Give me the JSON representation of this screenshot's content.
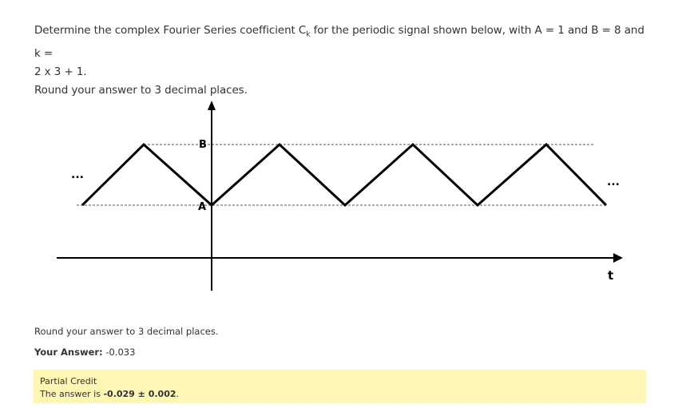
{
  "question": {
    "line1_pre": "Determine the complex Fourier Series coefficient C",
    "line1_sub": "k",
    "line1_post": " for the periodic signal shown below, with A = 1 and B = 8 and k =",
    "line2": "2 x 3 + 1.",
    "line3": "Round your answer to 3 decimal places."
  },
  "figure": {
    "label_B": "B",
    "label_A": "A",
    "axis_label_t": "t",
    "ellipsis_left": "...",
    "ellipsis_right": "..."
  },
  "round_note": "Round your answer to 3 decimal places.",
  "answer": {
    "label": "Your Answer:",
    "value": "-0.033"
  },
  "feedback": {
    "title": "Partial Credit",
    "text_pre": "The answer is ",
    "correct": "-0.029 ± 0.002",
    "text_post": "."
  },
  "colors": {
    "feedback_bg": "#fdf6b4",
    "text": "#333333",
    "line": "#000000"
  }
}
